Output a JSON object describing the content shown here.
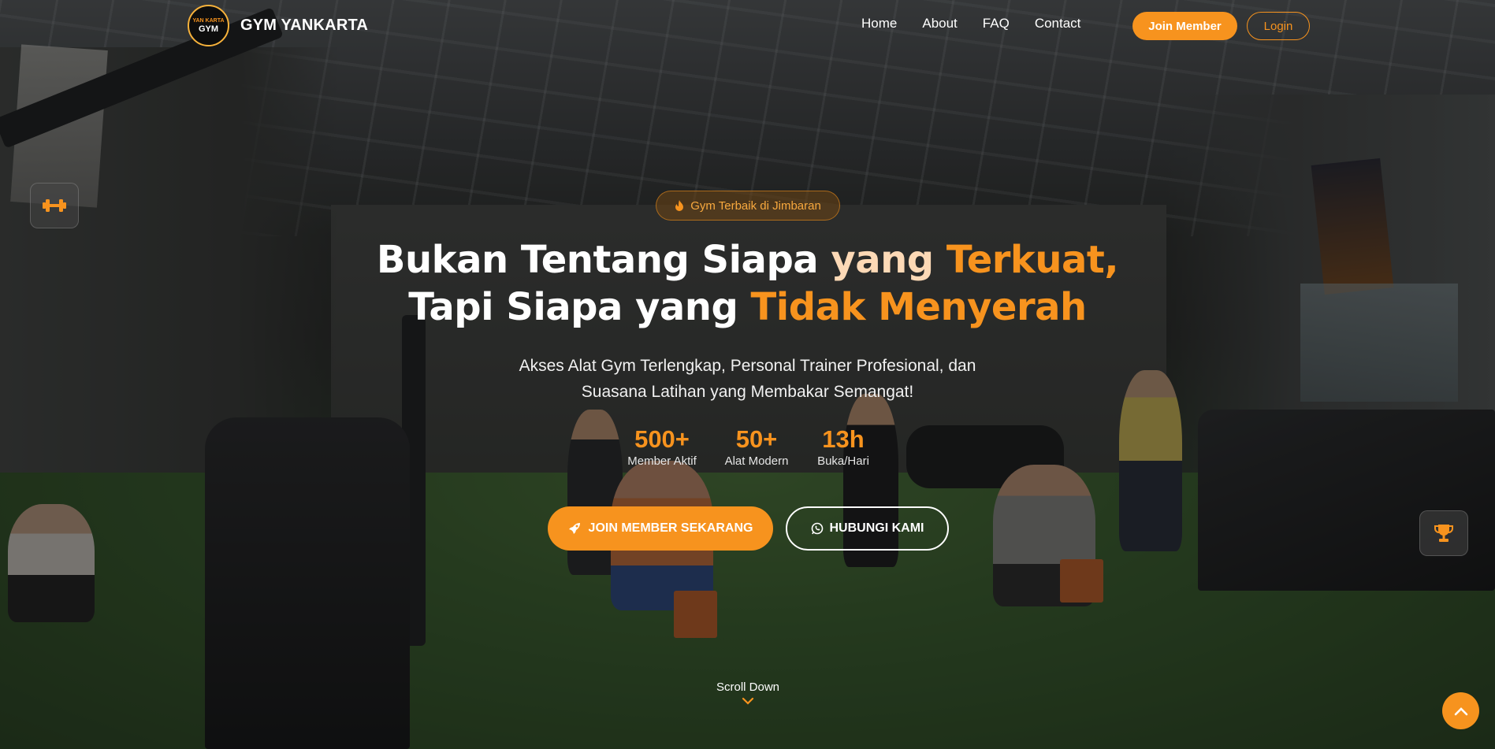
{
  "brand": {
    "logo_text_top": "YAN KARTA",
    "logo_text_bottom": "GYM",
    "name": "GYM YANKARTA"
  },
  "nav": {
    "links": [
      {
        "label": "Home"
      },
      {
        "label": "About"
      },
      {
        "label": "FAQ"
      },
      {
        "label": "Contact"
      }
    ],
    "join_label": "Join Member",
    "login_label": "Login"
  },
  "hero": {
    "badge_icon": "fire-icon",
    "badge_text": "Gym Terbaik di Jimbaran",
    "headline": {
      "line1_white": "Bukan Tentang Siapa ",
      "line1_peach": "yang ",
      "line1_orange": "Terkuat,",
      "line2_white": "Tapi Siapa yang ",
      "line2_orange": "Tidak Menyerah"
    },
    "subtitle_line1": "Akses Alat Gym Terlengkap, Personal Trainer Profesional, dan",
    "subtitle_line2": "Suasana Latihan yang Membakar Semangat!",
    "stats": [
      {
        "value": "500+",
        "label": "Member Aktif"
      },
      {
        "value": "50+",
        "label": "Alat Modern"
      },
      {
        "value": "13h",
        "label": "Buka/Hari"
      }
    ],
    "cta_primary": {
      "label": "JOIN MEMBER SEKARANG",
      "icon": "rocket-icon"
    },
    "cta_secondary": {
      "label": "HUBUNGI KAMI",
      "icon": "whatsapp-icon"
    },
    "scroll_label": "Scroll Down"
  },
  "floating": {
    "left_icon": "dumbbell-icon",
    "right_icon": "trophy-icon",
    "back_to_top_icon": "chevron-up-icon"
  },
  "colors": {
    "accent": "#f7931e",
    "peach": "#fcd9b6",
    "overlay": "rgba(10,10,10,0.48)"
  }
}
